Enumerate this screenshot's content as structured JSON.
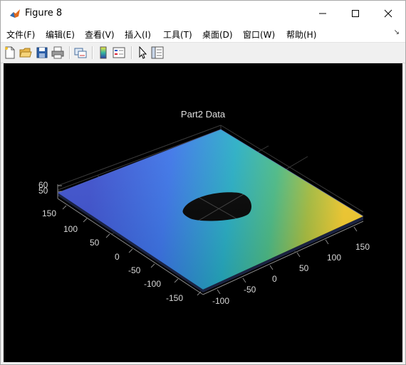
{
  "window": {
    "title": "Figure 8"
  },
  "menu": [
    "文件(F)",
    "编辑(E)",
    "查看(V)",
    "插入(I)",
    "工具(T)",
    "桌面(D)",
    "窗口(W)",
    "帮助(H)"
  ],
  "toolbar": [
    "new-figure",
    "open-file",
    "save-figure",
    "print-figure",
    "link-plot",
    "insert-colorbar",
    "insert-legend",
    "edit-plot",
    "property-inspector"
  ],
  "plot": {
    "title": "Part2 Data",
    "x_ticks": [
      "150",
      "100",
      "50",
      "0",
      "-50",
      "-100",
      "-150"
    ],
    "y_ticks": [
      "-100",
      "-50",
      "0",
      "50",
      "100",
      "150"
    ],
    "z_ticks": [
      "60",
      "50"
    ],
    "colormap": "parula"
  }
}
